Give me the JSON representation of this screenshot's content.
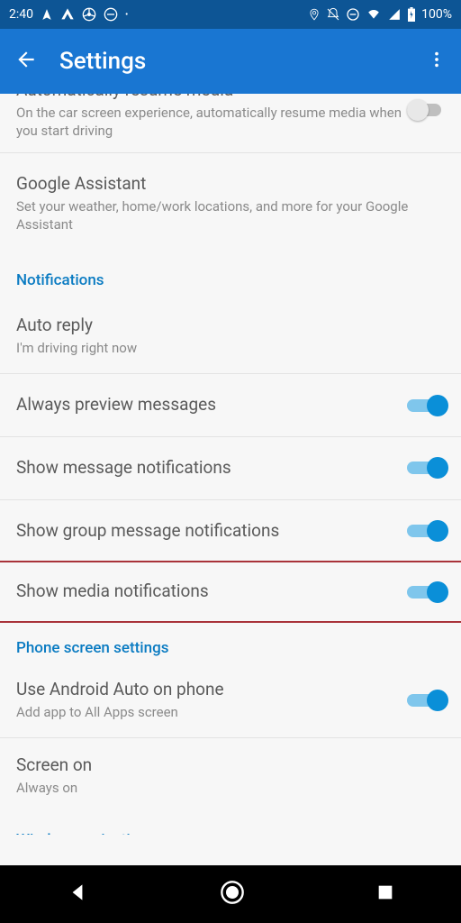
{
  "statusbar": {
    "time": "2:40",
    "battery": "100%"
  },
  "appbar": {
    "title": "Settings"
  },
  "rows": {
    "resume_media": {
      "label": "Automatically resume media",
      "sub": "On the car screen experience, automatically resume media when you start driving"
    },
    "assistant": {
      "label": "Google Assistant",
      "sub": "Set your weather, home/work locations, and more for your Google Assistant"
    },
    "auto_reply": {
      "label": "Auto reply",
      "sub": "I'm driving right now"
    },
    "preview": {
      "label": "Always preview messages"
    },
    "msg_notif": {
      "label": "Show message notifications"
    },
    "group_notif": {
      "label": "Show group message notifications"
    },
    "media_notif": {
      "label": "Show media notifications"
    },
    "use_aa": {
      "label": "Use Android Auto on phone",
      "sub": "Add app to All Apps screen"
    },
    "screen_on": {
      "label": "Screen on",
      "sub": "Always on"
    }
  },
  "sections": {
    "notifications": "Notifications",
    "phone": "Phone screen settings",
    "wireless": "Wireless projection"
  }
}
